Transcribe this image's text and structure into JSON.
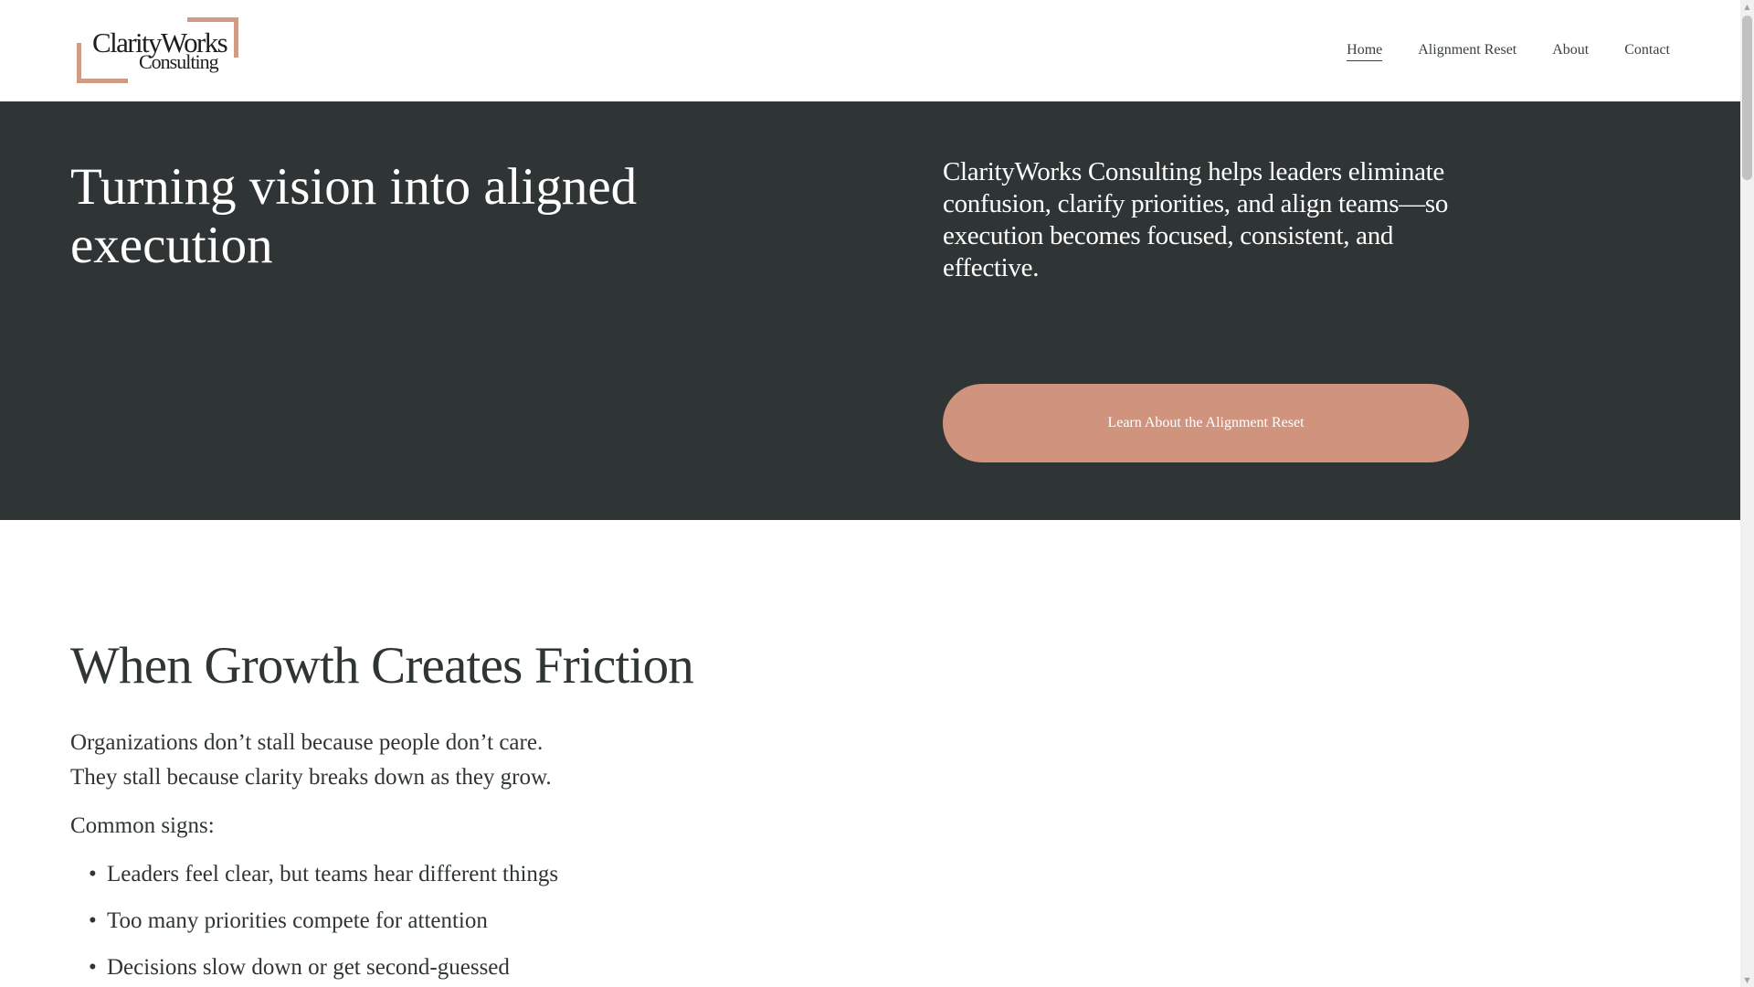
{
  "header": {
    "logo": {
      "line1": "ClarityWorks",
      "line2": "Consulting"
    },
    "nav": [
      {
        "label": "Home",
        "active": true
      },
      {
        "label": "Alignment Reset",
        "active": false
      },
      {
        "label": "About",
        "active": false
      },
      {
        "label": "Contact",
        "active": false
      }
    ]
  },
  "hero": {
    "title": "Turning vision into aligned execution",
    "description": "ClarityWorks Consulting helps leaders eliminate confusion, clarify priorities, and align teams—so execution becomes focused, consistent, and effective.",
    "button_label": "Learn About the Alignment Reset"
  },
  "section": {
    "title": "When Growth Creates Friction",
    "intro_lines": [
      "Organizations don’t stall because people don’t care.",
      "They stall because clarity breaks down as they grow."
    ],
    "signs_label": "Common signs:",
    "signs": [
      "Leaders feel clear, but teams hear different things",
      "Too many priorities compete for attention",
      "Decisions slow down or get second-guessed"
    ]
  },
  "colors": {
    "dark": "#2f3535",
    "accent": "#d0937d",
    "logo_accent": "#d09a85",
    "white": "#ffffff"
  },
  "icons": {
    "scroll_up": "scroll-up-arrow-icon",
    "scroll_down": "scroll-down-arrow-icon",
    "bullet": "bullet-icon"
  }
}
